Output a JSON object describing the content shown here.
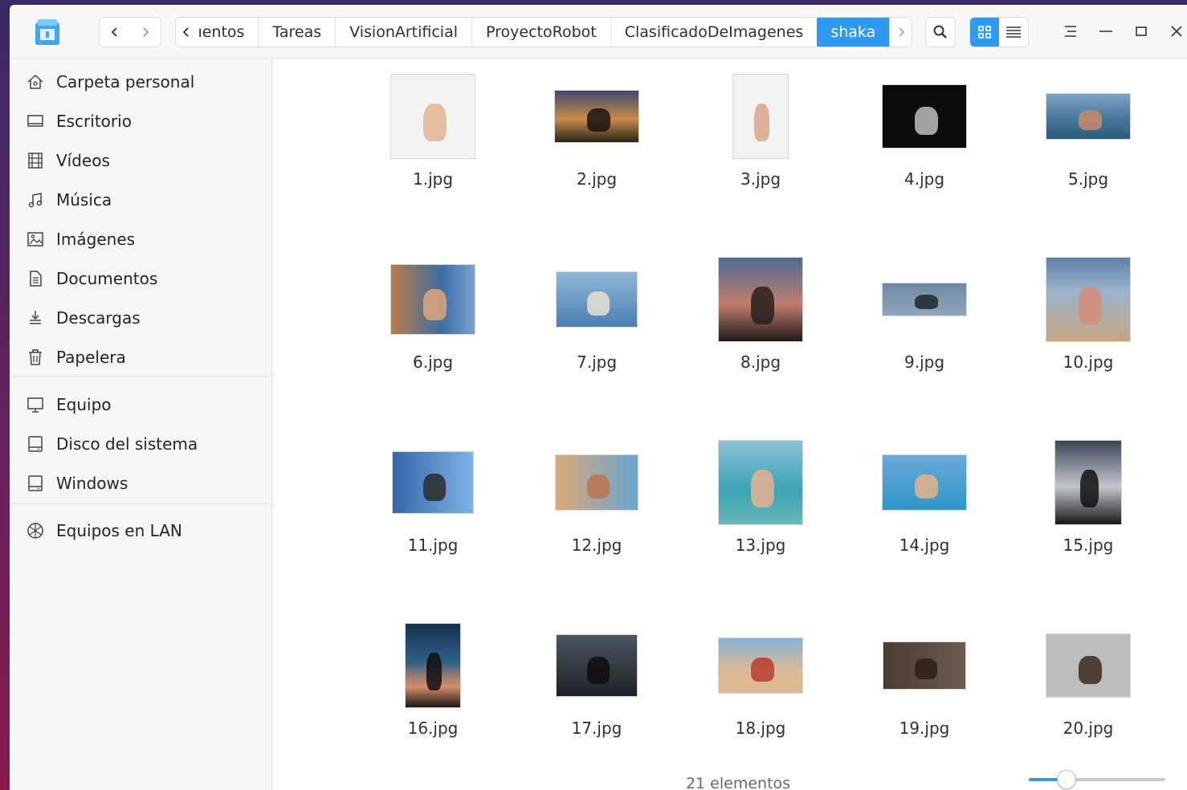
{
  "toolbar": {
    "breadcrumbs": [
      {
        "label": "ıentos",
        "active": false
      },
      {
        "label": "Tareas",
        "active": false
      },
      {
        "label": "VisionArtificial",
        "active": false
      },
      {
        "label": "ProyectoRobot",
        "active": false
      },
      {
        "label": "ClasificadoDeImagenes",
        "active": false
      },
      {
        "label": "shaka",
        "active": true
      }
    ],
    "view_mode": "icon-view",
    "accent": "#2f9af2"
  },
  "sidebar": {
    "items": [
      {
        "label": "Carpeta personal",
        "icon": "home-icon"
      },
      {
        "label": "Escritorio",
        "icon": "desktop-icon"
      },
      {
        "label": "Vídeos",
        "icon": "video-icon"
      },
      {
        "label": "Música",
        "icon": "music-icon"
      },
      {
        "label": "Imágenes",
        "icon": "image-icon"
      },
      {
        "label": "Documentos",
        "icon": "document-icon"
      },
      {
        "label": "Descargas",
        "icon": "download-icon"
      },
      {
        "label": "Papelera",
        "icon": "trash-icon"
      },
      {
        "label": "Equipo",
        "icon": "computer-icon"
      },
      {
        "label": "Disco del sistema",
        "icon": "disk-icon"
      },
      {
        "label": "Windows",
        "icon": "disk-icon"
      },
      {
        "label": "Equipos en LAN",
        "icon": "network-icon"
      }
    ]
  },
  "files": [
    {
      "name": "1.jpg"
    },
    {
      "name": "2.jpg"
    },
    {
      "name": "3.jpg"
    },
    {
      "name": "4.jpg"
    },
    {
      "name": "5.jpg"
    },
    {
      "name": "6.jpg"
    },
    {
      "name": "7.jpg"
    },
    {
      "name": "8.jpg"
    },
    {
      "name": "9.jpg"
    },
    {
      "name": "10.jpg"
    },
    {
      "name": "11.jpg"
    },
    {
      "name": "12.jpg"
    },
    {
      "name": "13.jpg"
    },
    {
      "name": "14.jpg"
    },
    {
      "name": "15.jpg"
    },
    {
      "name": "16.jpg"
    },
    {
      "name": "17.jpg"
    },
    {
      "name": "18.jpg"
    },
    {
      "name": "19.jpg"
    },
    {
      "name": "20.jpg"
    }
  ],
  "status": {
    "count_text": "21 elementos",
    "zoom_level": 0.27
  }
}
